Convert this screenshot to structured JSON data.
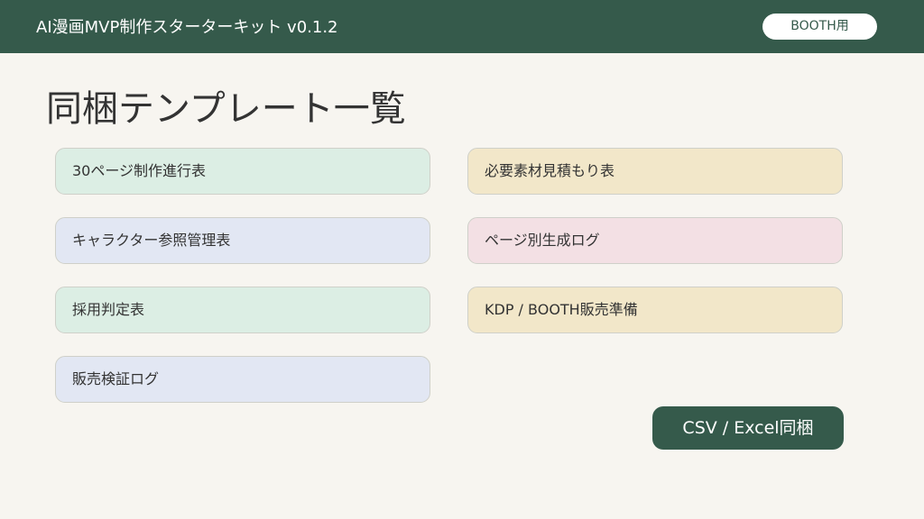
{
  "header": {
    "title": "AI漫画MVP制作スターターキット v0.1.2",
    "badge": "BOOTH用"
  },
  "main": {
    "title": "同梱テンプレート一覧",
    "templates_left": [
      {
        "label": "30ページ制作進行表"
      },
      {
        "label": "キャラクター参照管理表"
      },
      {
        "label": "採用判定表"
      },
      {
        "label": "販売検証ログ"
      }
    ],
    "templates_right": [
      {
        "label": "必要素材見積もり表"
      },
      {
        "label": "ページ別生成ログ"
      },
      {
        "label": "KDP / BOOTH販売準備"
      }
    ],
    "action_label": "CSV / Excel同梱"
  },
  "colors": {
    "brand": "#355a4b",
    "background": "#f7f5f0",
    "card_green": "#dceee4",
    "card_blue": "#e2e7f3",
    "card_yellow": "#f2e7c9",
    "card_pink": "#f3e0e4"
  }
}
